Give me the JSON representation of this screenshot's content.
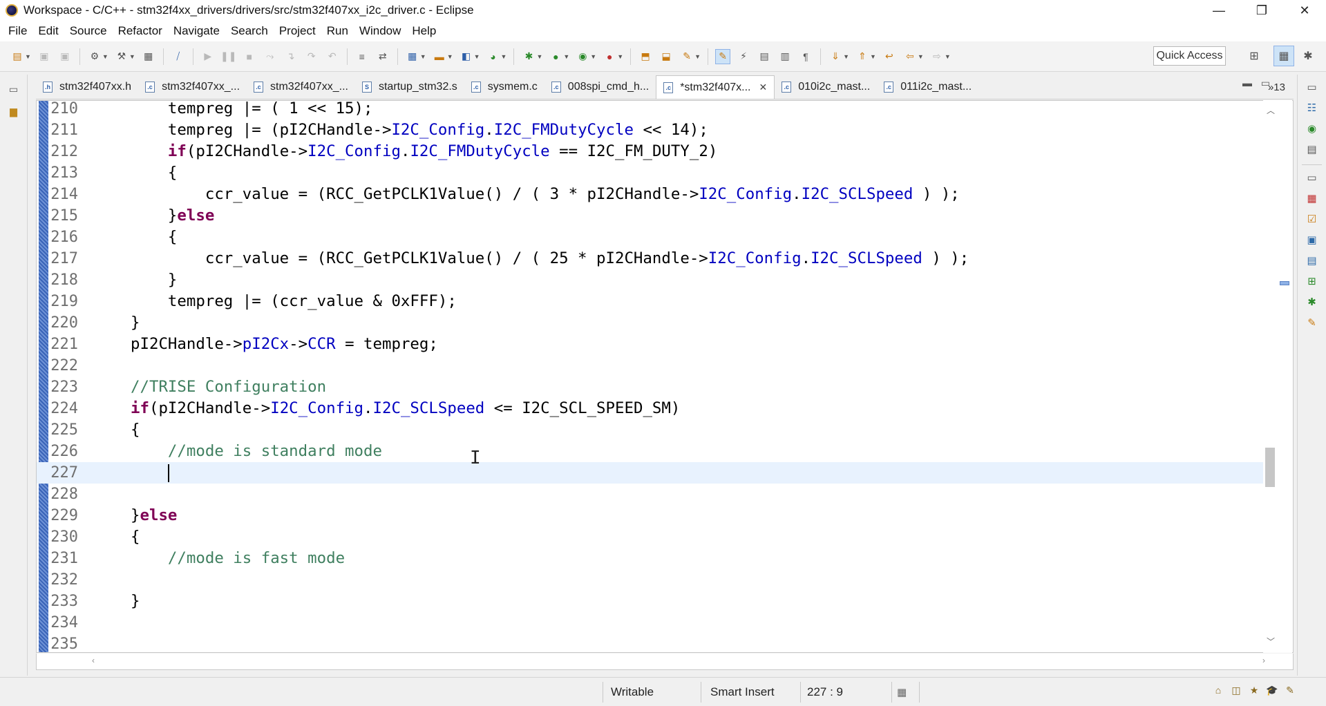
{
  "window": {
    "title": "Workspace - C/C++ - stm32f4xx_drivers/drivers/src/stm32f407xx_i2c_driver.c - Eclipse",
    "controls": [
      "—",
      "❐",
      "✕"
    ]
  },
  "menu": [
    "File",
    "Edit",
    "Source",
    "Refactor",
    "Navigate",
    "Search",
    "Project",
    "Run",
    "Window",
    "Help"
  ],
  "toolbar": {
    "quick_access": "Quick Access"
  },
  "tabs": [
    {
      "label": "stm32f407xx.h",
      "icon": "h-file-icon",
      "active": false
    },
    {
      "label": "stm32f407xx_...",
      "icon": "c-file-icon",
      "active": false
    },
    {
      "label": "stm32f407xx_...",
      "icon": "c-file-icon",
      "active": false
    },
    {
      "label": "startup_stm32.s",
      "icon": "s-file-icon",
      "active": false
    },
    {
      "label": "sysmem.c",
      "icon": "c-file-icon",
      "active": false
    },
    {
      "label": "008spi_cmd_h...",
      "icon": "c-file-icon",
      "active": false
    },
    {
      "label": "*stm32f407x...",
      "icon": "c-file-icon",
      "active": true
    },
    {
      "label": "010i2c_mast...",
      "icon": "c-file-icon",
      "active": false
    },
    {
      "label": "011i2c_mast...",
      "icon": "c-file-icon",
      "active": false
    }
  ],
  "tab_overflow": "»13",
  "editor": {
    "lines": [
      {
        "n": "210"
      },
      {
        "n": "211"
      },
      {
        "n": "212"
      },
      {
        "n": "213"
      },
      {
        "n": "214"
      },
      {
        "n": "215"
      },
      {
        "n": "216"
      },
      {
        "n": "217"
      },
      {
        "n": "218"
      },
      {
        "n": "219"
      },
      {
        "n": "220"
      },
      {
        "n": "221"
      },
      {
        "n": "222"
      },
      {
        "n": "223"
      },
      {
        "n": "224"
      },
      {
        "n": "225"
      },
      {
        "n": "226"
      },
      {
        "n": "227"
      },
      {
        "n": "228"
      },
      {
        "n": "229"
      },
      {
        "n": "230"
      },
      {
        "n": "231"
      },
      {
        "n": "232"
      },
      {
        "n": "233"
      },
      {
        "n": "234"
      },
      {
        "n": "235"
      }
    ],
    "current_line": "227"
  },
  "status": {
    "writable": "Writable",
    "insert_mode": "Smart Insert",
    "position": "227 : 9"
  }
}
